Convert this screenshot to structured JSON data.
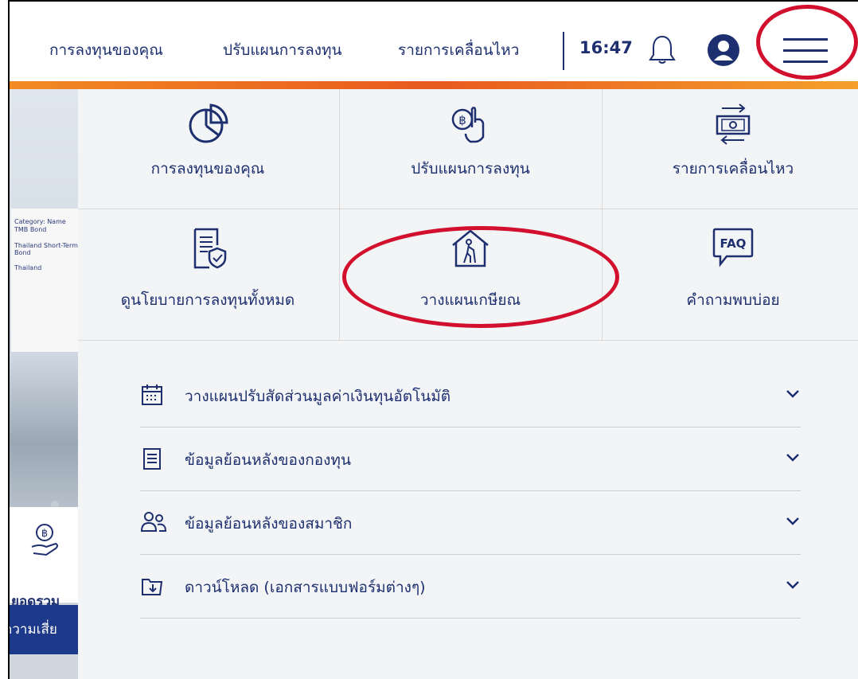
{
  "header": {
    "nav": [
      {
        "label": "การลงทุนของคุณ"
      },
      {
        "label": "ปรับแผนการลงทุน"
      },
      {
        "label": "รายการเคลื่อนไหว"
      }
    ],
    "time": "16:47",
    "icons": [
      "bell-icon",
      "user-avatar-icon",
      "hamburger-menu-icon"
    ]
  },
  "menu": {
    "tiles": [
      {
        "label": "การลงทุนของคุณ",
        "icon": "pie-chart-icon"
      },
      {
        "label": "ปรับแผนการลงทุน",
        "icon": "baht-hand-icon"
      },
      {
        "label": "รายการเคลื่อนไหว",
        "icon": "money-transfer-icon"
      },
      {
        "label": "ดูนโยบายการลงทุนทั้งหมด",
        "icon": "policy-document-icon"
      },
      {
        "label": "วางแผนเกษียณ",
        "icon": "retirement-house-icon"
      },
      {
        "label": "คำถามพบบ่อย",
        "icon": "faq-icon"
      }
    ],
    "faq_icon_text": "FAQ",
    "rows": [
      {
        "label": "วางแผนปรับสัดส่วนมูลค่าเงินทุนอัตโนมัติ",
        "icon": "calendar-icon"
      },
      {
        "label": "ข้อมูลย้อนหลังของกองทุน",
        "icon": "clipboard-list-icon"
      },
      {
        "label": "ข้อมูลย้อนหลังของสมาชิก",
        "icon": "members-icon"
      },
      {
        "label": "ดาวน์โหลด (เอกสารแบบฟอร์มต่างๆ)",
        "icon": "download-folder-icon"
      }
    ]
  },
  "background": {
    "summary_label": "ยอดรวม",
    "risk_label": "ความเสี่ย",
    "doc_lines": [
      "Category: Name",
      "TMB Bond",
      "Thailand Short-Term Bond",
      "Thailand"
    ]
  },
  "colors": {
    "primary": "#1d2f6f",
    "highlight_ring": "#d2102e",
    "accent_orange": "#f28a23",
    "panel_bg": "#f3f4f6"
  }
}
